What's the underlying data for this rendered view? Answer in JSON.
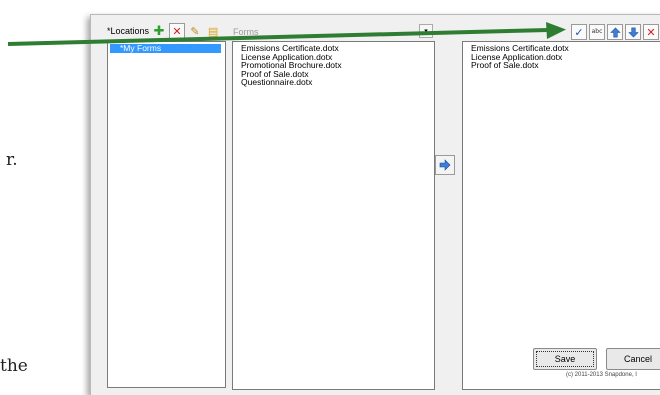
{
  "background_doc": {
    "fragment_1": "r.",
    "fragment_2": "the"
  },
  "dialog": {
    "locations": {
      "label": "*Locations",
      "items": [
        "*My Forms"
      ],
      "selected_index": 0,
      "toolbar_icons": [
        "add-icon",
        "delete-icon",
        "edit-icon",
        "folder-icon"
      ]
    },
    "forms": {
      "label": "Forms",
      "items": [
        "Emissions Certificate.dotx",
        "License Application.dotx",
        "Promotional Brochure.dotx",
        "Proof of Sale.dotx",
        "Questionnaire.dotx"
      ]
    },
    "selected": {
      "items": [
        "Emissions Certificate.dotx",
        "License Application.dotx",
        "Proof of Sale.dotx"
      ],
      "toolbar_icons": [
        "checkmark-icon",
        "spellcheck-icon",
        "move-up-icon",
        "move-down-icon",
        "delete-icon"
      ],
      "spellcheck_text": "abc"
    },
    "buttons": {
      "save": "Save",
      "cancel": "Cancel"
    },
    "copyright": "(c) 2011-2013 Snapdone, I"
  },
  "annotation": {
    "arrow_color": "#2e7d32"
  }
}
